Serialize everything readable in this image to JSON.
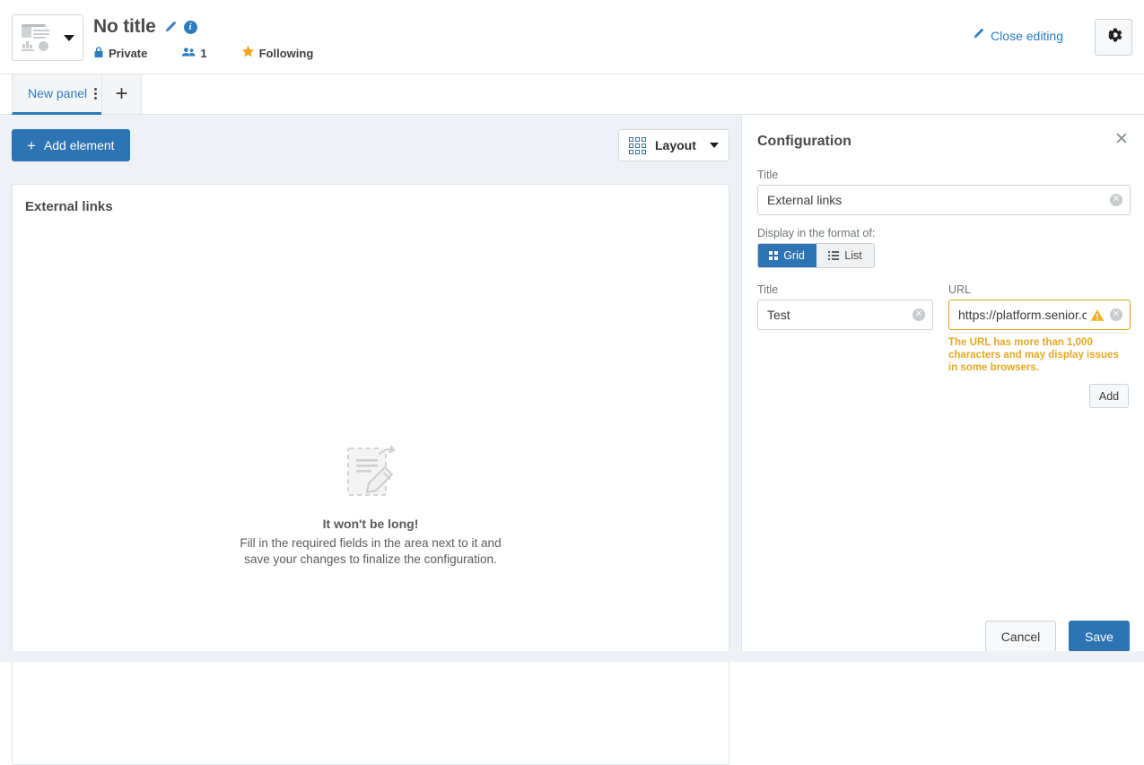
{
  "header": {
    "thumbnail_icon": "dashboard-thumbnail-icon",
    "title": "No title",
    "edit_icon": "pencil-icon",
    "info_icon": "info-icon",
    "visibility": "Private",
    "visibility_icon": "lock-icon",
    "members_count": "1",
    "members_icon": "people-icon",
    "following_label": "Following",
    "following_icon": "star-icon",
    "close_editing_label": "Close editing",
    "close_editing_icon": "pencil-icon",
    "settings_icon": "gear-icon"
  },
  "tabs": {
    "items": [
      {
        "label": "New panel",
        "menu_icon": "kebab-menu-icon"
      }
    ],
    "add_label": "+"
  },
  "toolbar": {
    "add_element_label": "Add element",
    "add_element_icon": "plus-icon",
    "layout_label": "Layout",
    "layout_icon": "grid-9-icon",
    "layout_caret": "caret-down-icon"
  },
  "panel": {
    "card_title": "External links",
    "empty_state": {
      "icon": "document-edit-dashed-icon",
      "title": "It won't be long!",
      "description_line1": "Fill in the required fields in the area next to it and",
      "description_line2": "save your changes to finalize the configuration."
    }
  },
  "configuration": {
    "heading": "Configuration",
    "close_icon": "close-icon",
    "title_field": {
      "label": "Title",
      "value": "External links",
      "clear_icon": "clear-circle-icon"
    },
    "format": {
      "label": "Display in the format of:",
      "options": [
        {
          "label": "Grid",
          "icon": "grid-4-icon",
          "selected": true
        },
        {
          "label": "List",
          "icon": "list-icon",
          "selected": false
        }
      ]
    },
    "link_title_field": {
      "label": "Title",
      "value": "Test",
      "clear_icon": "clear-circle-icon"
    },
    "link_url_field": {
      "label": "URL",
      "value": "https://platform.senior.c",
      "warning_icon": "warning-triangle-icon",
      "clear_icon": "clear-circle-icon",
      "warning_message": "The URL has more than 1,000 characters and may display issues in some browsers."
    },
    "add_label": "Add",
    "cancel_label": "Cancel",
    "save_label": "Save"
  },
  "colors": {
    "accent_blue": "#2c74b3",
    "warning_orange": "#e8a723",
    "star_orange": "#f5a623",
    "workspace_bg": "#eef1f5"
  }
}
